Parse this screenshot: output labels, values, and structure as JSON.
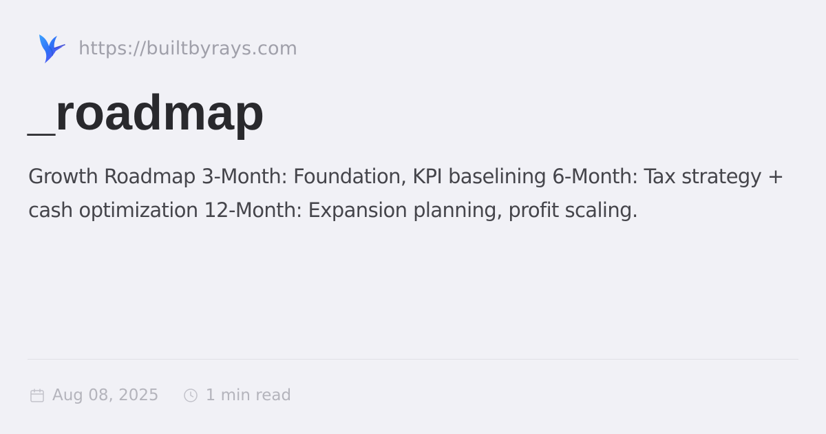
{
  "site": {
    "logo_icon": "hummingbird-logo-icon",
    "url": "https://builtbyrays.com"
  },
  "post": {
    "title": "_roadmap",
    "description": "Growth Roadmap 3-Month: Foundation, KPI baselining 6-Month: Tax strategy + cash optimization 12-Month: Expansion planning, profit scaling."
  },
  "meta": {
    "date_icon": "calendar-icon",
    "date": "Aug 08, 2025",
    "read_time_icon": "clock-icon",
    "read_time": "1 min read"
  },
  "colors": {
    "background": "#f1f1f6",
    "title": "#29292d",
    "description": "#45454b",
    "url": "#a0a0aa",
    "meta": "#b4b4bc",
    "logo_blue": "#2f6df6",
    "logo_purple": "#8b3df0"
  }
}
